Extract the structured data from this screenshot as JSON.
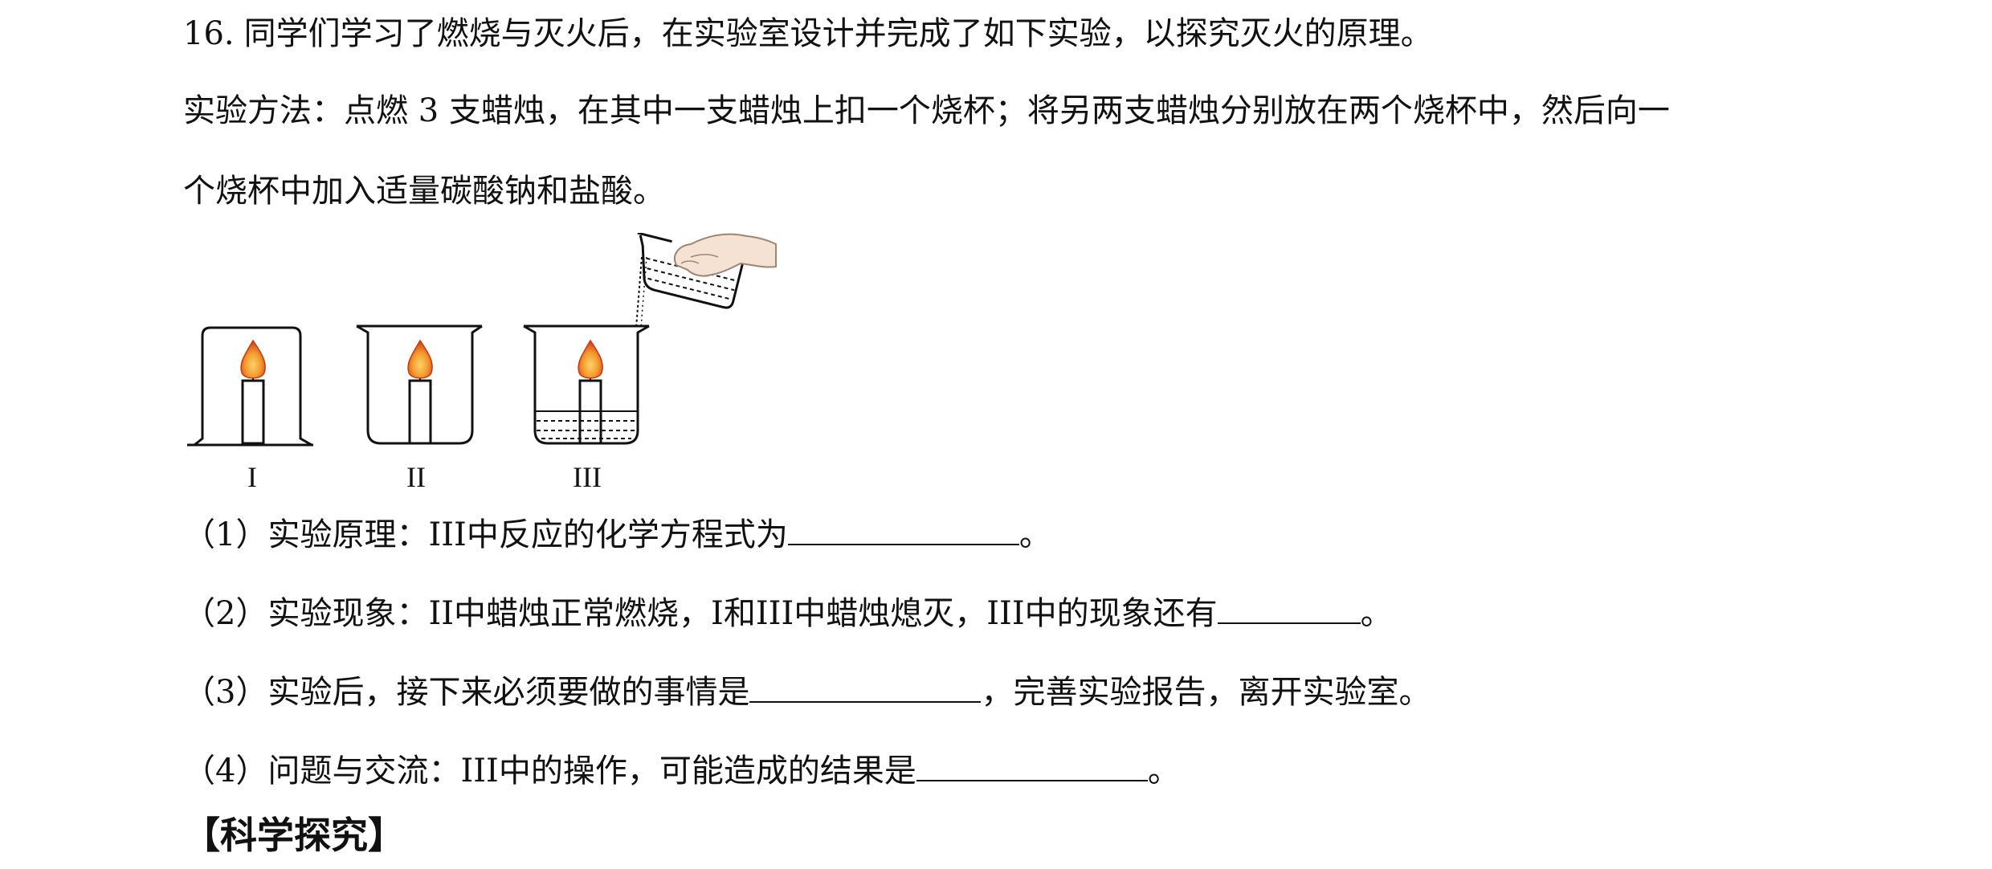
{
  "question": {
    "number": "16.",
    "intro": "同学们学习了燃烧与灭火后，在实验室设计并完成了如下实验，以探究灭火的原理。",
    "method_line1": "实验方法：点燃 3 支蜡烛，在其中一支蜡烛上扣一个烧杯；将另两支蜡烛分别放在两个烧杯中，然后向一",
    "method_line2": "个烧杯中加入适量碳酸钠和盐酸。"
  },
  "figure": {
    "labels": [
      "I",
      "II",
      "III"
    ]
  },
  "subquestions": [
    {
      "before": "（1）实验原理：III中反应的化学方程式为",
      "after": "。"
    },
    {
      "before": "（2）实验现象：II中蜡烛正常燃烧，I和III中蜡烛熄灭，III中的现象还有",
      "after": "。"
    },
    {
      "before": "（3）实验后，接下来必须要做的事情是",
      "after": "，完善实验报告，离开实验室。"
    },
    {
      "before": "（4）问题与交流：III中的操作，可能造成的结果是",
      "after": "。"
    }
  ],
  "section_heading": "【科学探究】",
  "colors": {
    "flame_outer": "#e8541e",
    "flame_inner": "#f6b23a",
    "text": "#111111"
  }
}
